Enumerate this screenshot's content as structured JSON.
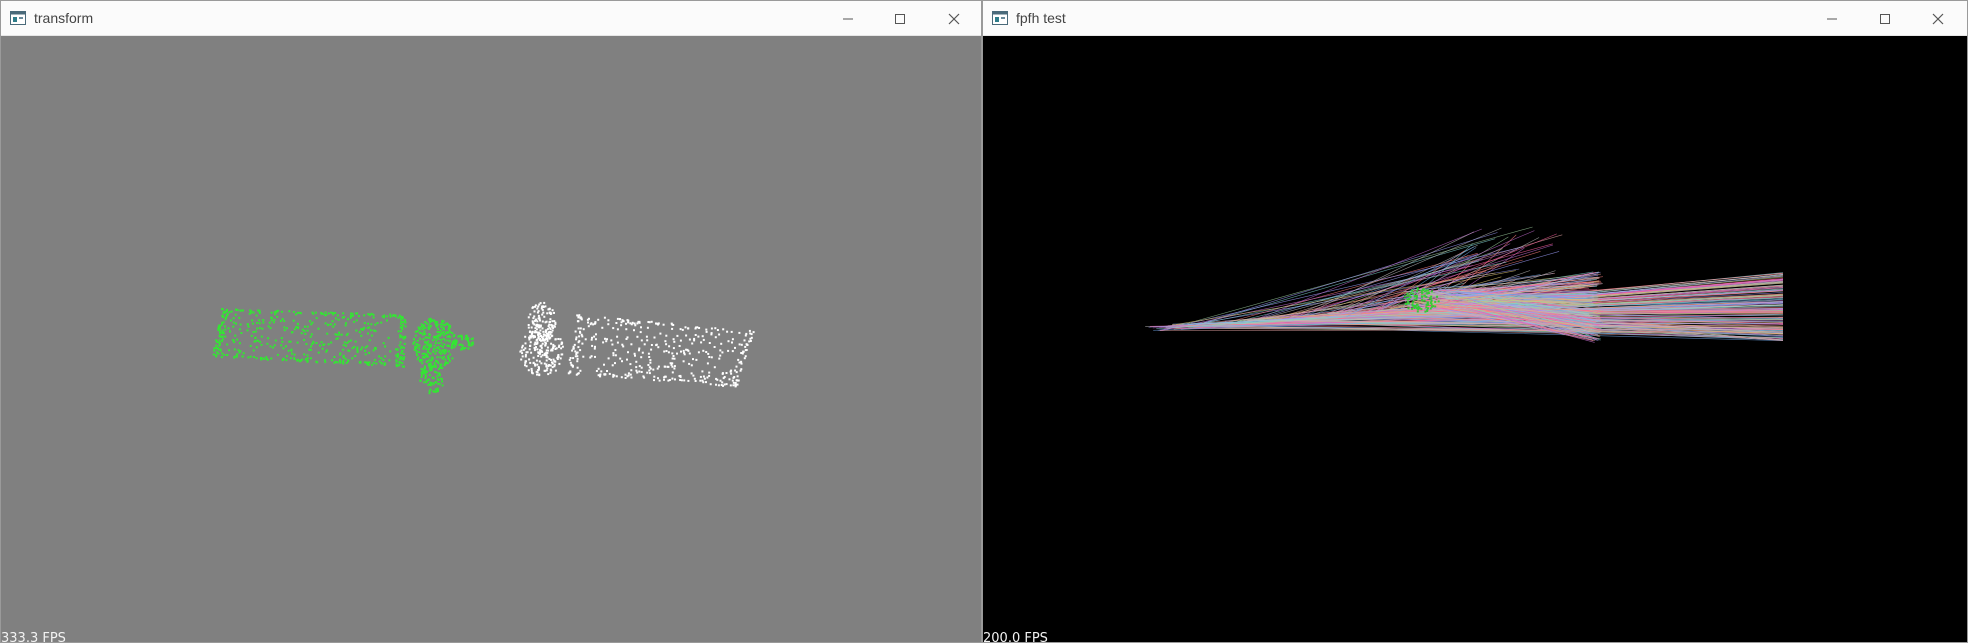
{
  "left_window": {
    "title": "transform",
    "fps": "333.3 FPS",
    "background": "#808080",
    "source_cloud_color": "#33e633",
    "target_cloud_color": "#ffffff"
  },
  "right_window": {
    "title": "fpfh test",
    "fps": "200.0 FPS",
    "background": "#000000",
    "cloud_color": "#33cc33"
  },
  "icons": {
    "app": "app-window-icon",
    "minimize": "minimize-icon",
    "maximize": "maximize-icon",
    "close": "close-icon"
  }
}
